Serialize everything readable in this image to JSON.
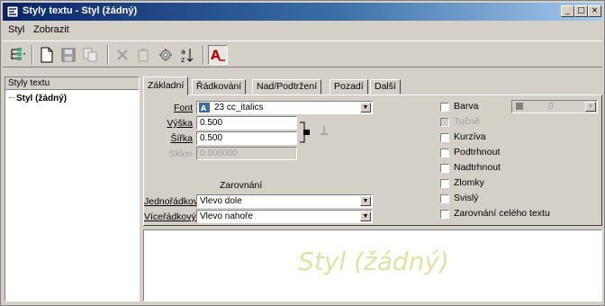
{
  "window": {
    "title": "Styly textu - Styl (žádný)"
  },
  "menu": {
    "items": [
      "Styl",
      "Zobrazit"
    ]
  },
  "toolbar": {
    "buttons": [
      "tree-view-icon",
      "new-style-icon",
      "save-icon",
      "copy-icon",
      "delete-icon",
      "paste-icon",
      "settings-icon",
      "sort-icon",
      "text-style-icon"
    ]
  },
  "left_panel": {
    "header": "Styly textu",
    "item": "Styl (žádný)"
  },
  "tabs": [
    {
      "label": "Základní",
      "active": true
    },
    {
      "label": "Řádkování",
      "active": false
    },
    {
      "label": "Nad/Podtržení",
      "active": false
    },
    {
      "label": "Pozadí",
      "active": false
    },
    {
      "label": "Další",
      "active": false
    }
  ],
  "form": {
    "font_label": "Font",
    "font_value": "23   cc_italics",
    "vyska_label": "Výška",
    "vyska_value": "0.500",
    "sirka_label": "Šířka",
    "sirka_value": "0.500",
    "sklon_label": "Sklon",
    "sklon_value": "0.000000",
    "zarovnani_label": "Zarovnání",
    "jednoradkovy_label": "Jednořádkový",
    "jednoradkovy_value": "Vlevo dole",
    "viceradkovy_label": "Víceřádkový",
    "viceradkovy_value": "Vlevo nahoře"
  },
  "checkboxes": [
    {
      "label": "Barva",
      "enabled": true
    },
    {
      "label": "Tučně",
      "enabled": false
    },
    {
      "label": "Kurzíva",
      "enabled": true
    },
    {
      "label": "Podtrhnout",
      "enabled": true
    },
    {
      "label": "Nadtrhnout",
      "enabled": true
    },
    {
      "label": "Zlomky",
      "enabled": true
    },
    {
      "label": "Svislý",
      "enabled": true
    },
    {
      "label": "Zarovnání celého textu",
      "enabled": true
    }
  ],
  "color_picker": {
    "value": "0",
    "swatch_color": "#808080"
  },
  "preview": {
    "text": "Styl (žádný)"
  },
  "colors": {
    "title_start": "#0a246a",
    "title_end": "#a6caf0",
    "face": "#d4d0c8",
    "preview_text": "#e2e2a0"
  }
}
